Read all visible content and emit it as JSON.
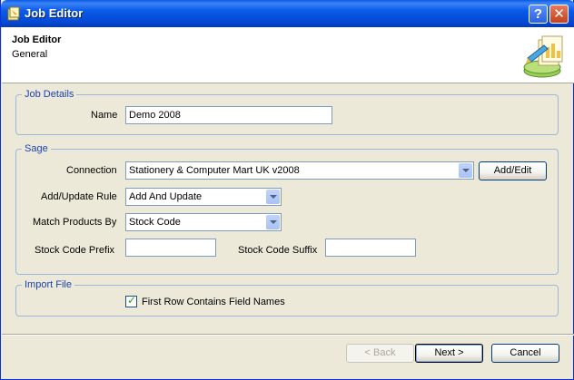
{
  "window": {
    "title": "Job Editor",
    "help_glyph": "?",
    "close_glyph": "✕"
  },
  "header": {
    "title": "Job Editor",
    "subtitle": "General"
  },
  "job_details": {
    "legend": "Job Details",
    "name_label": "Name",
    "name_value": "Demo 2008"
  },
  "sage": {
    "legend": "Sage",
    "connection_label": "Connection",
    "connection_value": "Stationery & Computer Mart UK v2008",
    "add_edit_label": "Add/Edit",
    "rule_label": "Add/Update Rule",
    "rule_value": "Add And Update",
    "match_label": "Match Products By",
    "match_value": "Stock Code",
    "prefix_label": "Stock Code Prefix",
    "prefix_value": "",
    "suffix_label": "Stock Code Suffix",
    "suffix_value": ""
  },
  "import_file": {
    "legend": "Import File",
    "first_row_label": "First Row Contains Field Names",
    "first_row_checked": true
  },
  "footer": {
    "back_label": "< Back",
    "next_label": "Next >",
    "cancel_label": "Cancel"
  },
  "colors": {
    "titlebar": "#0a5ae8",
    "group_border": "#9fb6dd",
    "legend_text": "#1c43b4"
  }
}
